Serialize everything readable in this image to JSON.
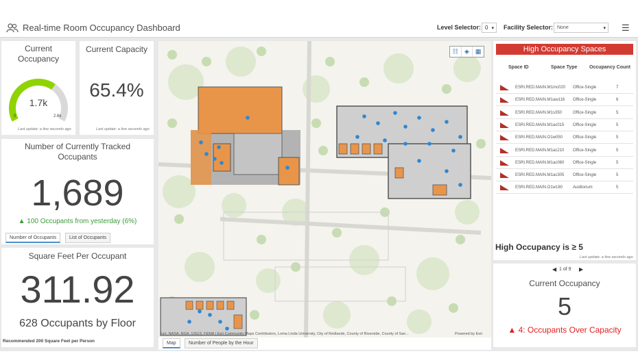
{
  "header": {
    "title": "Real-time Room Occupancy Dashboard",
    "people_icon": "people-icon",
    "level_label": "Level Selector:",
    "level_value": "0",
    "facility_label": "Facility Selector:",
    "facility_value": "None",
    "menu_icon": "hamburger-menu-icon"
  },
  "gauge": {
    "title_line1": "Current",
    "title_line2": "Occupancy",
    "value": "1.7k",
    "min": "0",
    "max": "2.6k",
    "fill_fraction": 0.65,
    "color": "#8fd400",
    "update": "Last update: a few seconds ago"
  },
  "capacity": {
    "title": "Current Capacity",
    "value": "65.4%",
    "update": "Last update: a few seconds ago"
  },
  "tracked": {
    "title_line1": "Number of Currently Tracked",
    "title_line2": "Occupants",
    "value": "1,689",
    "delta": "▲ 100 Occupants from yesterday (6%)",
    "delta_color": "#3a9a3a",
    "tabs": [
      "Number of Occupants",
      "List of Occupants"
    ]
  },
  "sqft": {
    "title": "Square Feet Per Occupant",
    "value": "311.92",
    "sub": "628 Occupants by Floor",
    "note": "Recommended 200 Square Feet per Person"
  },
  "map": {
    "attribution": "Esri, NASA, NGA, USGS, FEMA | Esri Community Maps Contributors, Loma Linda University, City of Redlands, County of Riverside, County of San...",
    "powered": "Powered by Esri",
    "tabs": [
      "Map",
      "Number of People by the Hour"
    ],
    "tools": [
      "legend-icon",
      "layers-icon",
      "qr-icon"
    ],
    "room_color": "#e8954a",
    "building_color": "#b3b3b3",
    "dot_color": "#2f86d4"
  },
  "high_occupancy": {
    "title": "High Occupancy Spaces",
    "columns": [
      "Space ID",
      "Space Type",
      "Occupancy Count"
    ],
    "rows": [
      {
        "id": "ESRI.RED.MAIN.M1mc020",
        "type": "Office-Single",
        "count": "7"
      },
      {
        "id": "ESRI.RED.MAIN.M1aw116",
        "type": "Office-Single",
        "count": "6"
      },
      {
        "id": "ESRI.RED.MAIN.M1s350",
        "type": "Office-Single",
        "count": "5"
      },
      {
        "id": "ESRI.RED.MAIN.M1ac015",
        "type": "Office-Single",
        "count": "5"
      },
      {
        "id": "ESRI.RED.MAIN.O1w050",
        "type": "Office-Single",
        "count": "5"
      },
      {
        "id": "ESRI.RED.MAIN.M1ac210",
        "type": "Office-Single",
        "count": "5"
      },
      {
        "id": "ESRI.RED.MAIN.M1ac060",
        "type": "Office-Single",
        "count": "5"
      },
      {
        "id": "ESRI.RED.MAIN.M1ac305",
        "type": "Office-Single",
        "count": "5"
      },
      {
        "id": "ESRI.RED.MAIN.O1w180",
        "type": "Auditorium",
        "count": "5"
      }
    ],
    "footer": "High Occupancy is ≥ 5",
    "update": "Last update: a few seconds ago",
    "header_color": "#d23b32"
  },
  "detail": {
    "pager": "1 of 9",
    "title": "Current Occupancy",
    "value": "5",
    "over": "▲ 4: Occupants Over Capacity",
    "over_color": "#e02020"
  }
}
